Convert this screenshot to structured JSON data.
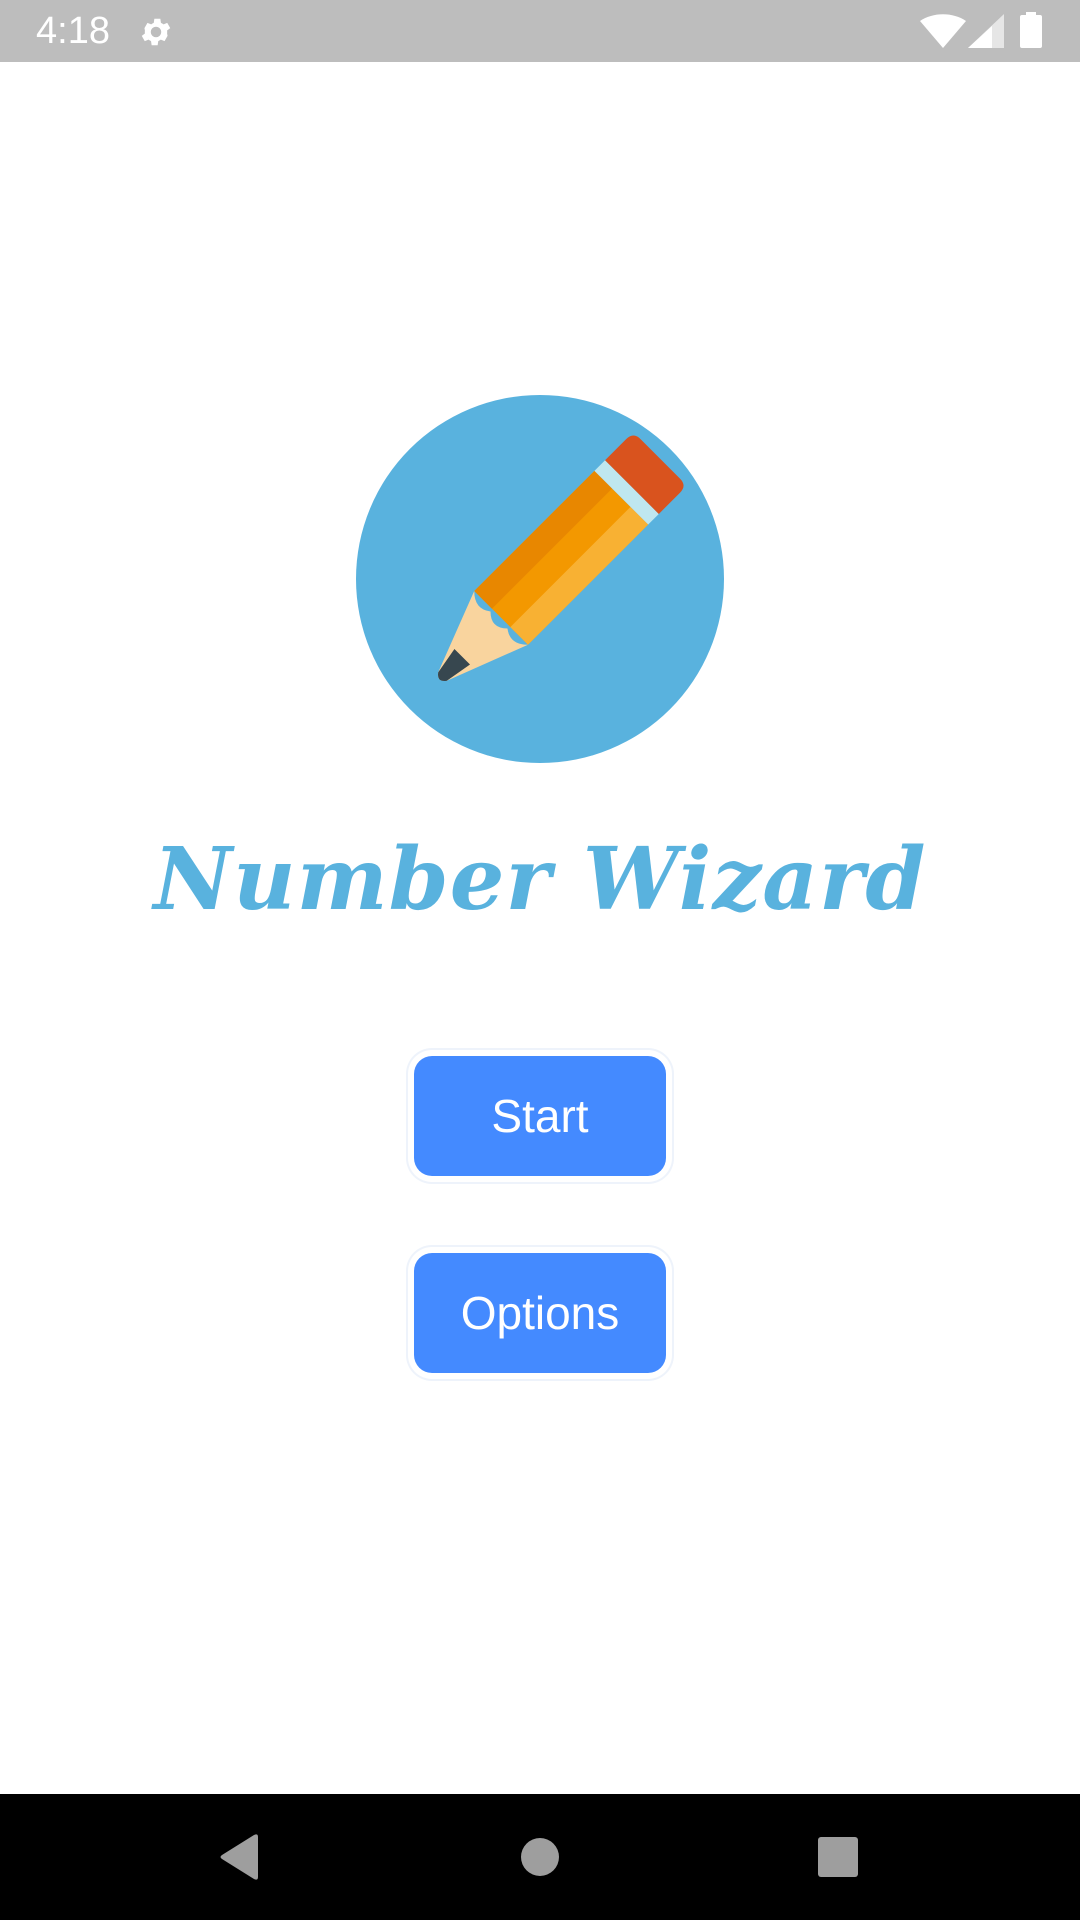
{
  "status_bar": {
    "time": "4:18",
    "icons": [
      "gear-icon",
      "wifi-icon",
      "signal-icon",
      "battery-icon"
    ]
  },
  "app": {
    "title": "Number Wizard",
    "logo_icon": "pencil-icon",
    "logo_background_color": "#59b2de",
    "title_color": "#59b2de"
  },
  "buttons": {
    "start_label": "Start",
    "options_label": "Options",
    "color": "#448aff"
  },
  "nav_bar": {
    "icons": [
      "back-icon",
      "home-icon",
      "recents-icon"
    ]
  }
}
